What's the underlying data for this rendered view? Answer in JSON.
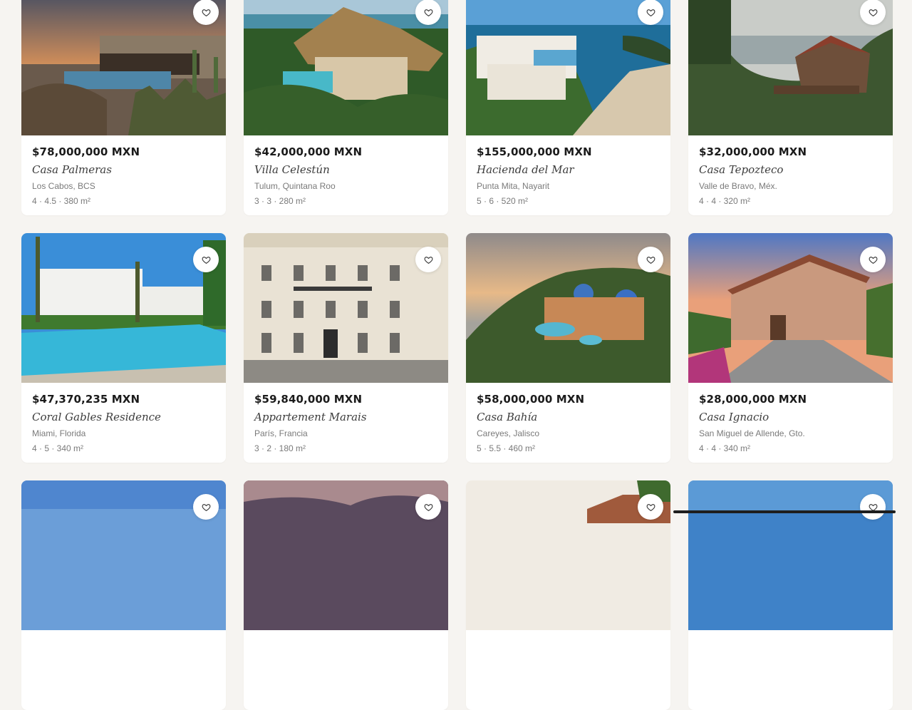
{
  "listings": [
    {
      "price": "$78,000,000 MXN",
      "name": "Casa Palmeras",
      "location": "Los Cabos, BCS",
      "specs": "4 · 4.5 · 380 m²"
    },
    {
      "price": "$42,000,000 MXN",
      "name": "Villa Celestún",
      "location": "Tulum, Quintana Roo",
      "specs": "3 · 3 · 280 m²"
    },
    {
      "price": "$155,000,000 MXN",
      "name": "Hacienda del Mar",
      "location": "Punta Mita, Nayarit",
      "specs": "5 · 6 · 520 m²"
    },
    {
      "price": "$32,000,000 MXN",
      "name": "Casa Tepozteco",
      "location": "Valle de Bravo, Méx.",
      "specs": "4 · 4 · 320 m²"
    },
    {
      "price": "$47,370,235 MXN",
      "name": "Coral Gables Residence",
      "location": "Miami, Florida",
      "specs": "4 · 5 · 340 m²"
    },
    {
      "price": "$59,840,000 MXN",
      "name": "Appartement Marais",
      "location": "París, Francia",
      "specs": "3 · 2 · 180 m²"
    },
    {
      "price": "$58,000,000 MXN",
      "name": "Casa Bahía",
      "location": "Careyes, Jalisco",
      "specs": "5 · 5.5 · 460 m²"
    },
    {
      "price": "$28,000,000 MXN",
      "name": "Casa Ignacio",
      "location": "San Miguel de Allende, Gto.",
      "specs": "4 · 4 · 340 m²"
    },
    {
      "price": "",
      "name": "",
      "location": "",
      "specs": ""
    },
    {
      "price": "",
      "name": "",
      "location": "",
      "specs": ""
    },
    {
      "price": "",
      "name": "",
      "location": "",
      "specs": ""
    },
    {
      "price": "",
      "name": "",
      "location": "",
      "specs": ""
    }
  ],
  "icons": {
    "favorite": "heart-outline-icon"
  },
  "colors": {
    "background": "#f6f4f1",
    "card": "#ffffff",
    "price": "#1b1b1b",
    "muted": "#7a7a7a"
  }
}
